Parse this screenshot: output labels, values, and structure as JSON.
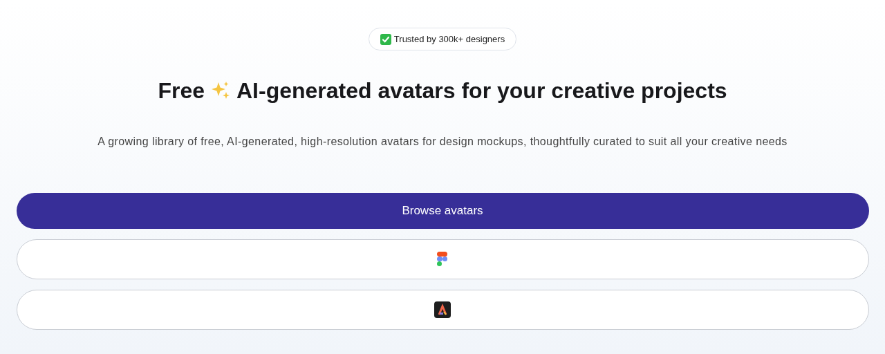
{
  "badge": {
    "text": "Trusted by 300k+ designers"
  },
  "heading": {
    "before": "Free",
    "after": "AI-generated avatars for your creative projects"
  },
  "subtitle": "A growing library of free, AI-generated, high-resolution avatars for design mockups, thoughtfully curated to suit all your creative needs",
  "buttons": [
    {
      "kind": "primary",
      "label": "Browse avatars"
    },
    {
      "kind": "shapes"
    },
    {
      "kind": "app"
    }
  ]
}
